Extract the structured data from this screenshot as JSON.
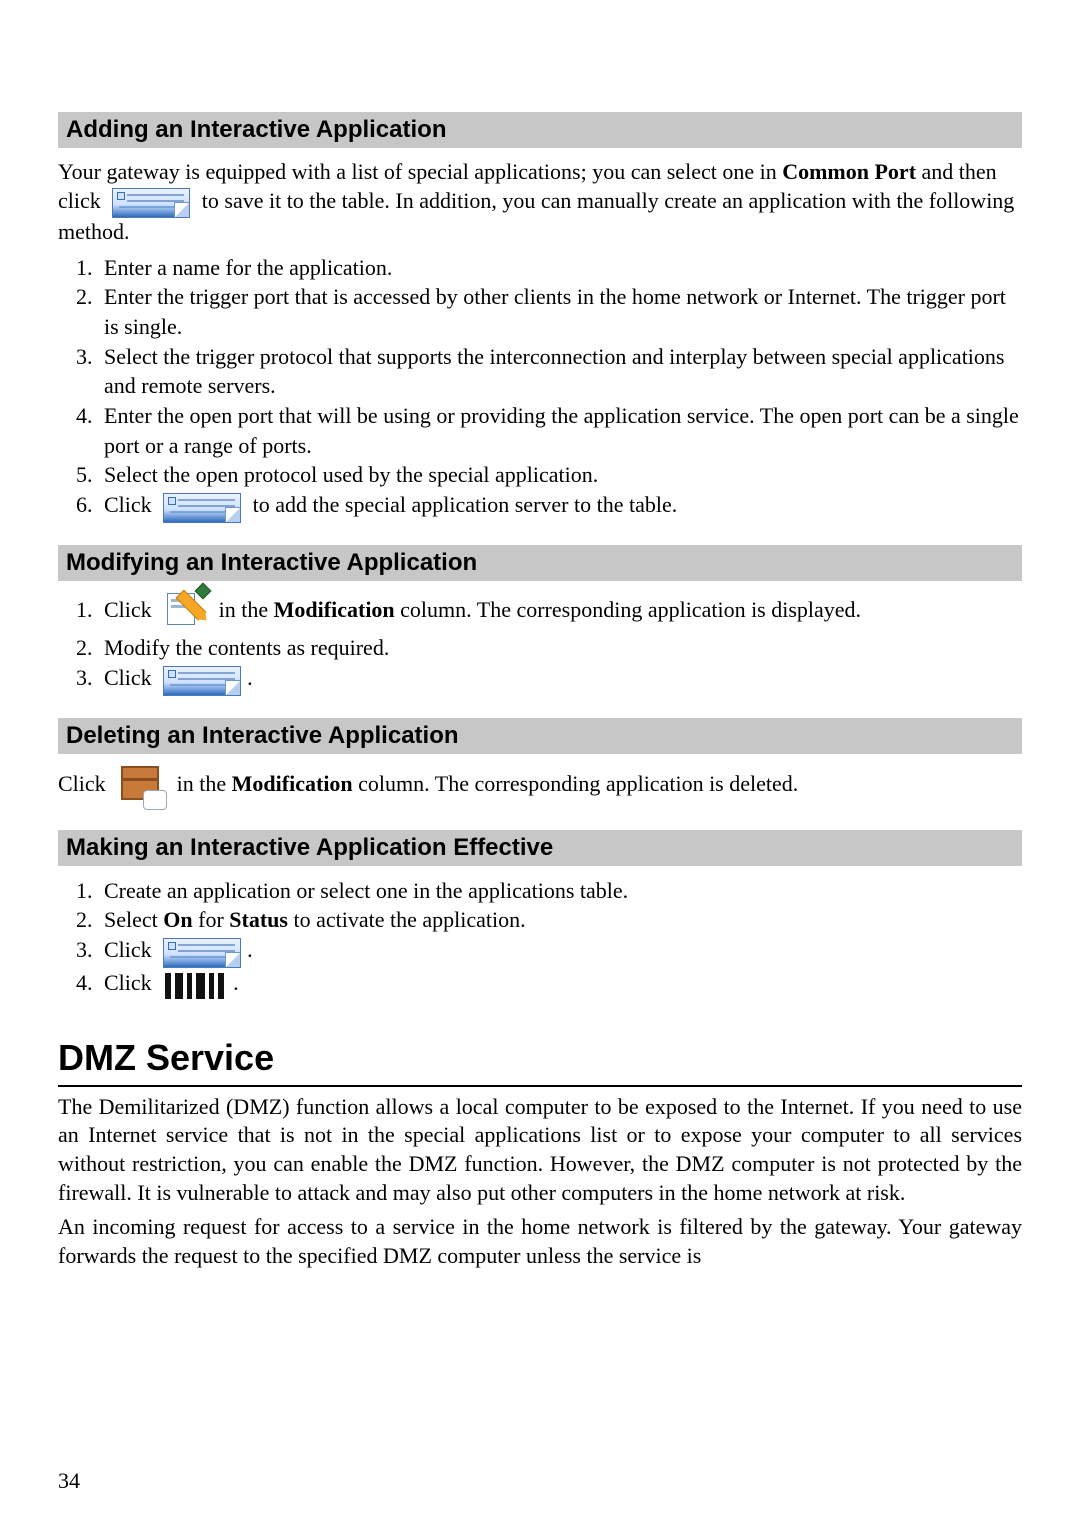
{
  "sections": {
    "adding": {
      "title": "Adding an Interactive Application"
    },
    "modifying": {
      "title": "Modifying an Interactive Application"
    },
    "deleting": {
      "title": "Deleting an Interactive Application"
    },
    "effective": {
      "title": "Making an Interactive Application Effective"
    }
  },
  "adding": {
    "intro_a": "Your gateway is equipped with a list of special applications; you can select one in ",
    "intro_bold": "Common Port",
    "intro_b": " and then click ",
    "intro_c": " to save it to the table. In addition, you can manually create an application with the following method.",
    "steps": [
      "Enter a name for the application.",
      "Enter the trigger port that is accessed by other clients in the home network or Internet. The trigger port is single.",
      "Select the trigger protocol that supports the interconnection and interplay between special applications and remote servers.",
      "Enter the open port that will be using or providing the application service. The open port can be a single port or a range of ports.",
      "Select the open protocol used by the special application."
    ],
    "step6_a": "Click ",
    "step6_b": " to add the special application server to the table."
  },
  "modifying": {
    "step1_a": "Click ",
    "step1_b": " in the ",
    "step1_bold": "Modification",
    "step1_c": " column. The corresponding application is displayed.",
    "step2": "Modify the contents as required.",
    "step3_a": "Click ",
    "step3_b": "."
  },
  "deleting": {
    "line_a": "Click ",
    "line_b": " in the ",
    "line_bold": "Modification",
    "line_c": " column. The corresponding application is deleted."
  },
  "effective": {
    "step1": "Create an application or select one in the applications table.",
    "step2_a": "Select ",
    "step2_on": "On",
    "step2_b": " for ",
    "step2_status": "Status",
    "step2_c": " to activate the application.",
    "step3_a": "Click ",
    "step3_b": ".",
    "step4_a": "Click ",
    "step4_b": "."
  },
  "dmz": {
    "title": "DMZ Service",
    "para1": "The Demilitarized (DMZ) function allows a local computer to be exposed to the Internet. If you need to use an Internet service that is not in the special applications list or to expose your computer to all services without restriction, you can enable the DMZ function. However, the DMZ computer is not protected by the firewall. It is vulnerable to attack and may also put other computers in the home network at risk.",
    "para2": "An incoming request for access to a service in the home network is filtered by the gateway. Your gateway forwards the request to the specified DMZ computer unless the service is"
  },
  "page_number": "34"
}
